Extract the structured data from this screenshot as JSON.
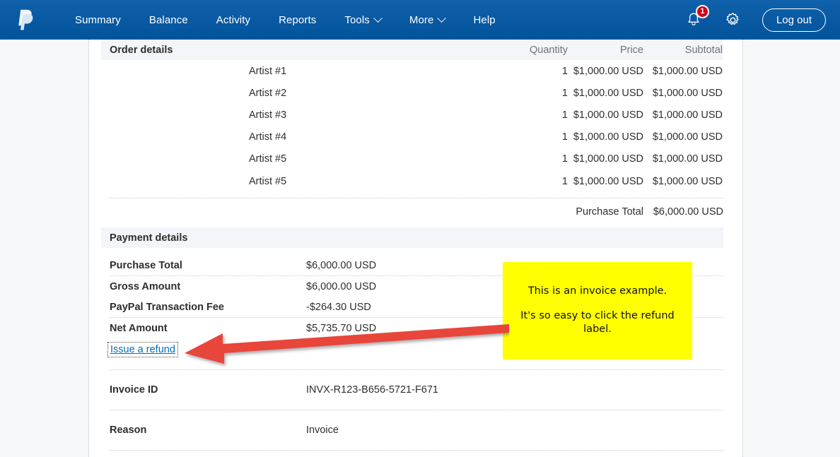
{
  "nav": {
    "logo_icon": "paypal-logo-icon",
    "links": [
      {
        "label": "Summary",
        "has_chevron": false
      },
      {
        "label": "Balance",
        "has_chevron": false
      },
      {
        "label": "Activity",
        "has_chevron": false
      },
      {
        "label": "Reports",
        "has_chevron": false
      },
      {
        "label": "Tools",
        "has_chevron": true
      },
      {
        "label": "More",
        "has_chevron": true
      },
      {
        "label": "Help",
        "has_chevron": false
      }
    ],
    "notifications": {
      "icon": "bell-icon",
      "count": "1",
      "badge_color": "#d0021b"
    },
    "settings_icon": "gear-icon",
    "logout_label": "Log out",
    "background_color": "#00559b"
  },
  "order_details": {
    "title": "Order details",
    "columns": [
      "Quantity",
      "Price",
      "Subtotal"
    ],
    "rows": [
      {
        "name": "Artist #1",
        "quantity": "1",
        "price": "$1,000.00 USD",
        "subtotal": "$1,000.00 USD"
      },
      {
        "name": "Artist #2",
        "quantity": "1",
        "price": "$1,000.00 USD",
        "subtotal": "$1,000.00 USD"
      },
      {
        "name": "Artist #3",
        "quantity": "1",
        "price": "$1,000.00 USD",
        "subtotal": "$1,000.00 USD"
      },
      {
        "name": "Artist #4",
        "quantity": "1",
        "price": "$1,000.00 USD",
        "subtotal": "$1,000.00 USD"
      },
      {
        "name": "Artist #5",
        "quantity": "1",
        "price": "$1,000.00 USD",
        "subtotal": "$1,000.00 USD"
      },
      {
        "name": "Artist #5",
        "quantity": "1",
        "price": "$1,000.00 USD",
        "subtotal": "$1,000.00 USD"
      }
    ],
    "total_label": "Purchase Total",
    "total_value": "$6,000.00 USD"
  },
  "payment_details": {
    "title": "Payment details",
    "rows": [
      {
        "label": "Purchase Total",
        "value": "$6,000.00 USD"
      },
      {
        "label": "Gross Amount",
        "value": "$6,000.00 USD"
      },
      {
        "label": "PayPal Transaction Fee",
        "value": "-$264.30 USD"
      },
      {
        "label": "Net Amount",
        "value": "$5,735.70 USD"
      }
    ],
    "refund_link_label": "Issue a refund",
    "refund_link_color": "#0070ba"
  },
  "info": {
    "invoice_id_label": "Invoice ID",
    "invoice_id_value": "INVX-R123-B656-5721-F671",
    "reason_label": "Reason",
    "reason_value": "Invoice"
  },
  "annotation": {
    "note_line_1": "This is an invoice example.",
    "note_line_2": "It's so easy to click the refund label.",
    "note_background": "#ffff00",
    "arrow_color": "#e8443a",
    "arrow_direction": "left"
  }
}
